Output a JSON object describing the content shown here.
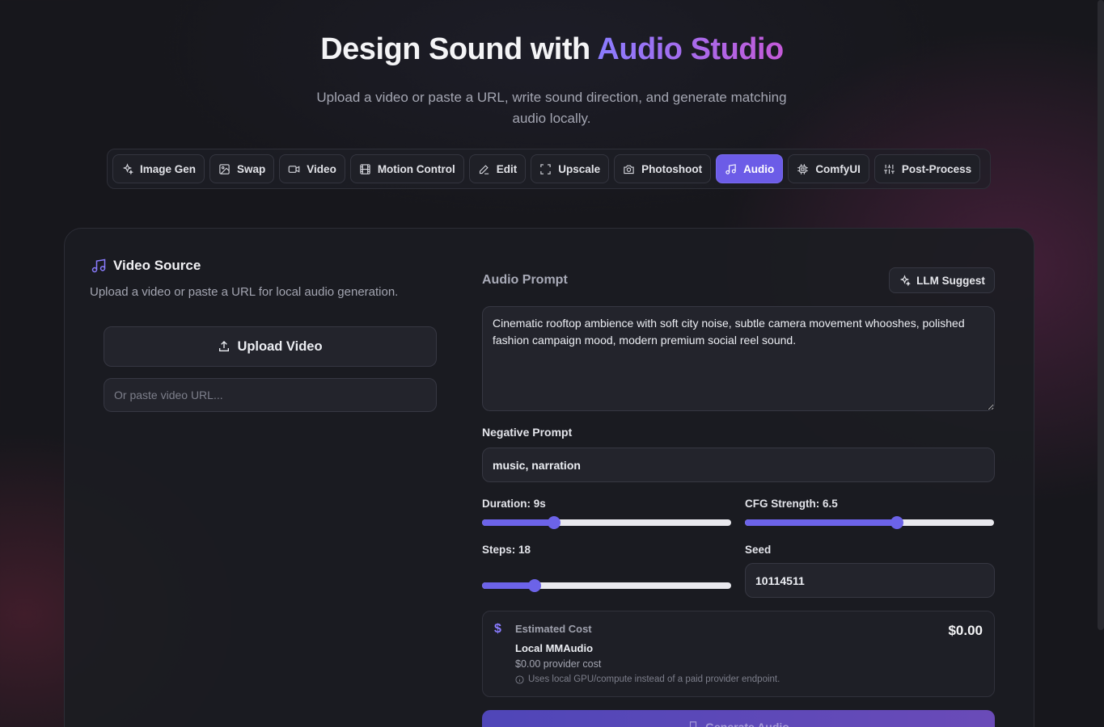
{
  "header": {
    "title_prefix": "Design Sound with ",
    "title_accent": "Audio Studio",
    "subtitle": "Upload a video or paste a URL, write sound direction, and generate matching audio locally."
  },
  "tabs": [
    {
      "label": "Image Gen",
      "icon": "sparkles-icon",
      "active": false
    },
    {
      "label": "Swap",
      "icon": "image-icon",
      "active": false
    },
    {
      "label": "Video",
      "icon": "video-camera-icon",
      "active": false
    },
    {
      "label": "Motion Control",
      "icon": "film-icon",
      "active": false
    },
    {
      "label": "Edit",
      "icon": "pencil-icon",
      "active": false
    },
    {
      "label": "Upscale",
      "icon": "expand-icon",
      "active": false
    },
    {
      "label": "Photoshoot",
      "icon": "camera-icon",
      "active": false
    },
    {
      "label": "Audio",
      "icon": "music-note-icon",
      "active": true
    },
    {
      "label": "ComfyUI",
      "icon": "chip-icon",
      "active": false
    },
    {
      "label": "Post-Process",
      "icon": "sliders-icon",
      "active": false
    }
  ],
  "video_source": {
    "title": "Video Source",
    "description": "Upload a video or paste a URL for local audio generation.",
    "upload_label": "Upload Video",
    "url_placeholder": "Or paste video URL...",
    "url_value": ""
  },
  "audio_prompt": {
    "label": "Audio Prompt",
    "llm_label": "LLM Suggest",
    "value": "Cinematic rooftop ambience with soft city noise, subtle camera movement whooshes, polished fashion campaign mood, modern premium social reel sound."
  },
  "negative_prompt": {
    "label": "Negative Prompt",
    "value": "music, narration"
  },
  "sliders": {
    "duration": {
      "label": "Duration: 9s",
      "value": 9,
      "fraction": 0.29
    },
    "cfg": {
      "label": "CFG Strength: 6.5",
      "value": 6.5,
      "fraction": 0.61
    },
    "steps": {
      "label": "Steps: 18",
      "value": 18,
      "fraction": 0.21
    }
  },
  "seed": {
    "label": "Seed",
    "value": "10114511"
  },
  "cost": {
    "title": "Estimated Cost",
    "provider": "Local MMAudio",
    "provider_cost": "$0.00 provider cost",
    "note": "Uses local GPU/compute instead of a paid provider endpoint.",
    "amount": "$0.00",
    "icon": "dollar-icon"
  },
  "generate_label": "Generate Audio",
  "colors": {
    "accent": "#6c5ce7",
    "background": "#17171c",
    "panel": "#1b1c22"
  }
}
